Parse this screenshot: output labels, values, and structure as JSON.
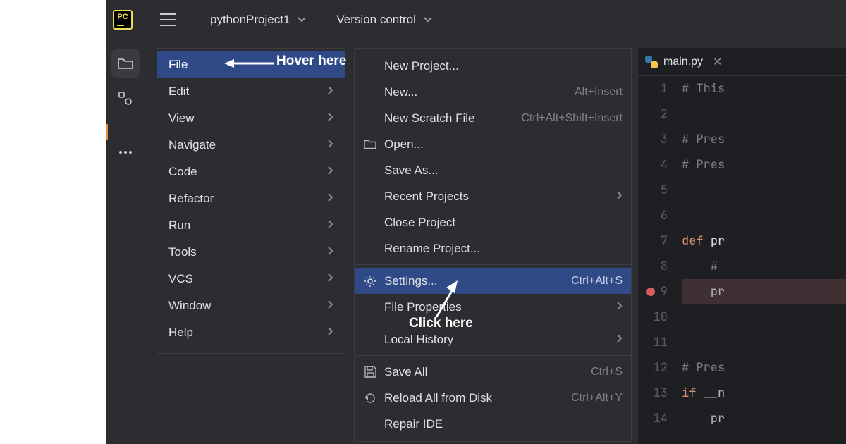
{
  "titlebar": {
    "logo_text": "PC",
    "project_name": "pythonProject1",
    "version_control": "Version control"
  },
  "main_menu": [
    {
      "label": "File",
      "selected": true,
      "submenu": false
    },
    {
      "label": "Edit",
      "submenu": true
    },
    {
      "label": "View",
      "submenu": true
    },
    {
      "label": "Navigate",
      "submenu": true
    },
    {
      "label": "Code",
      "submenu": true
    },
    {
      "label": "Refactor",
      "submenu": true
    },
    {
      "label": "Run",
      "submenu": true
    },
    {
      "label": "Tools",
      "submenu": true
    },
    {
      "label": "VCS",
      "submenu": true
    },
    {
      "label": "Window",
      "submenu": true
    },
    {
      "label": "Help",
      "submenu": true
    }
  ],
  "file_submenu": [
    {
      "label": "New Project...",
      "icon": "",
      "shortcut": ""
    },
    {
      "label": "New...",
      "icon": "",
      "shortcut": "Alt+Insert"
    },
    {
      "label": "New Scratch File",
      "icon": "",
      "shortcut": "Ctrl+Alt+Shift+Insert"
    },
    {
      "label": "Open...",
      "icon": "folder",
      "shortcut": ""
    },
    {
      "label": "Save As...",
      "icon": "",
      "shortcut": ""
    },
    {
      "label": "Recent Projects",
      "icon": "",
      "shortcut": "",
      "submenu": true
    },
    {
      "label": "Close Project",
      "icon": "",
      "shortcut": ""
    },
    {
      "label": "Rename Project...",
      "icon": "",
      "shortcut": ""
    },
    {
      "sep": true
    },
    {
      "label": "Settings...",
      "icon": "gear",
      "shortcut": "Ctrl+Alt+S",
      "highlight": true
    },
    {
      "label": "File Properties",
      "icon": "",
      "shortcut": "",
      "submenu": true
    },
    {
      "sep": true
    },
    {
      "label": "Local History",
      "icon": "",
      "shortcut": "",
      "submenu": true
    },
    {
      "sep": true
    },
    {
      "label": "Save All",
      "icon": "save",
      "shortcut": "Ctrl+S"
    },
    {
      "label": "Reload All from Disk",
      "icon": "reload",
      "shortcut": "Ctrl+Alt+Y"
    },
    {
      "label": "Repair IDE",
      "icon": "",
      "shortcut": ""
    }
  ],
  "editor": {
    "tab_name": "main.py",
    "lines": [
      {
        "n": 1,
        "cls": "cm",
        "text": "# This"
      },
      {
        "n": 2,
        "cls": "",
        "text": ""
      },
      {
        "n": 3,
        "cls": "cm",
        "text": "# Pres"
      },
      {
        "n": 4,
        "cls": "cm",
        "text": "# Pres"
      },
      {
        "n": 5,
        "cls": "",
        "text": ""
      },
      {
        "n": 6,
        "cls": "",
        "text": ""
      },
      {
        "n": 7,
        "cls": "def",
        "text": "def pr"
      },
      {
        "n": 8,
        "cls": "cm",
        "indent": 1,
        "text": "# "
      },
      {
        "n": 9,
        "cls": "hl",
        "indent": 1,
        "text": "pr"
      },
      {
        "n": 10,
        "cls": "",
        "text": ""
      },
      {
        "n": 11,
        "cls": "",
        "text": ""
      },
      {
        "n": 12,
        "cls": "cm",
        "text": "# Pres"
      },
      {
        "n": 13,
        "cls": "if",
        "text": "if __n"
      },
      {
        "n": 14,
        "cls": "",
        "indent": 1,
        "text": "pr"
      }
    ]
  },
  "annotations": {
    "hover": "Hover here",
    "click": "Click here"
  }
}
